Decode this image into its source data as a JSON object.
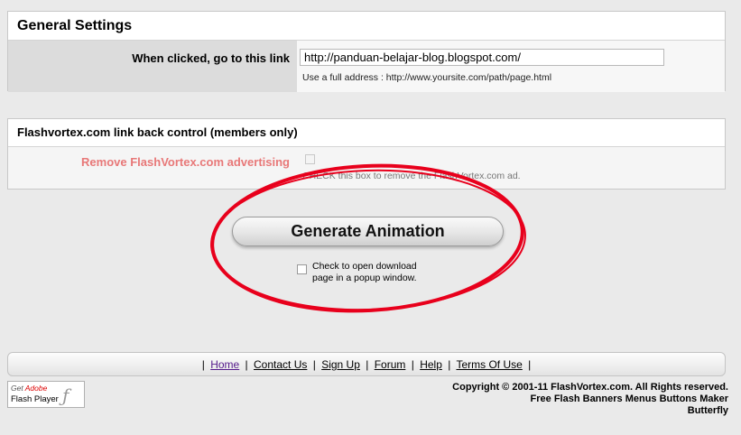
{
  "general": {
    "title": "General Settings",
    "link_label": "When clicked, go to this link",
    "link_value": "http://panduan-belajar-blog.blogspot.com/",
    "link_hint": "Use a full address : http://www.yoursite.com/path/page.html"
  },
  "linkback": {
    "title": "Flashvortex.com link back control (members only)",
    "remove_label": "Remove FlashVortex.com advertising",
    "remove_hint": "CHECK this box to remove the FlashVortex.com ad."
  },
  "actions": {
    "generate_label": "Generate Animation",
    "popup_label": "Check to open download page in a popup window."
  },
  "nav": {
    "items": [
      "Home",
      "Contact Us",
      "Sign Up",
      "Forum",
      "Help",
      "Terms Of Use"
    ],
    "separator": "|"
  },
  "badge": {
    "get": "Get",
    "adobe": "Adobe",
    "player": "Flash Player",
    "icon": "flash-f-icon"
  },
  "footer": {
    "copyright": "Copyright © 2001-11 FlashVortex.com. All Rights reserved.",
    "tagline": "Free Flash Banners Menus Buttons Maker",
    "effect": "Butterfly"
  },
  "colors": {
    "background": "#eaeaea",
    "remove_label": "#e87878",
    "annotation_ellipse": "#e8001c",
    "visited_link": "#551a8b"
  }
}
